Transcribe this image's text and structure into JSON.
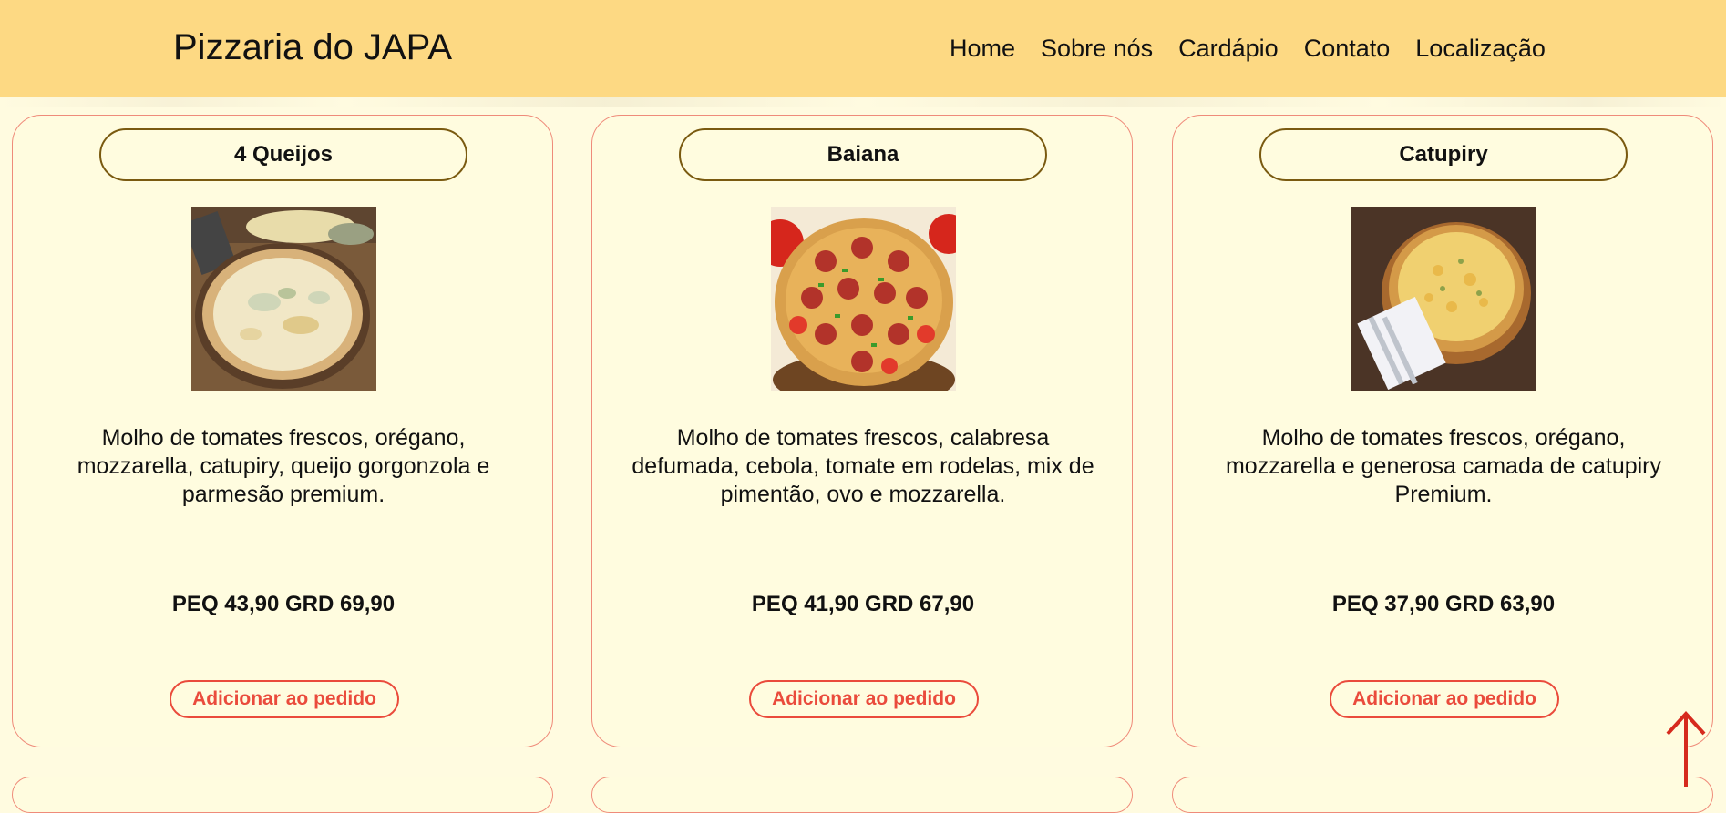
{
  "header": {
    "brand": "Pizzaria do JAPA",
    "nav": [
      "Home",
      "Sobre nós",
      "Cardápio",
      "Contato",
      "Localização"
    ]
  },
  "menu": [
    {
      "name": "4 Queijos",
      "photo": "four-cheese-pizza",
      "description": "Molho de tomates frescos, orégano, mozzarella, catupiry, queijo gorgonzola e parmesão premium.",
      "price": "PEQ 43,90 GRD 69,90",
      "button": "Adicionar ao pedido"
    },
    {
      "name": "Baiana",
      "photo": "baiana-pizza",
      "description": "Molho de tomates frescos, calabresa defumada, cebola, tomate em rodelas, mix de pimentão, ovo e mozzarella.",
      "price": "PEQ 41,90 GRD 67,90",
      "button": "Adicionar ao pedido"
    },
    {
      "name": "Catupiry",
      "photo": "catupiry-pizza",
      "description": "Molho de tomates frescos, orégano, mozzarella e generosa camada de catupiry Premium.",
      "price": "PEQ 37,90 GRD 63,90",
      "button": "Adicionar ao pedido"
    }
  ],
  "colors": {
    "header_bg": "#fdd983",
    "page_bg": "#fffbe0",
    "card_border": "#ef8b7a",
    "accent_red": "#ea4b3c",
    "pill_border": "#7a5a10"
  },
  "icons": {
    "scroll_top": "arrow-up-icon"
  }
}
